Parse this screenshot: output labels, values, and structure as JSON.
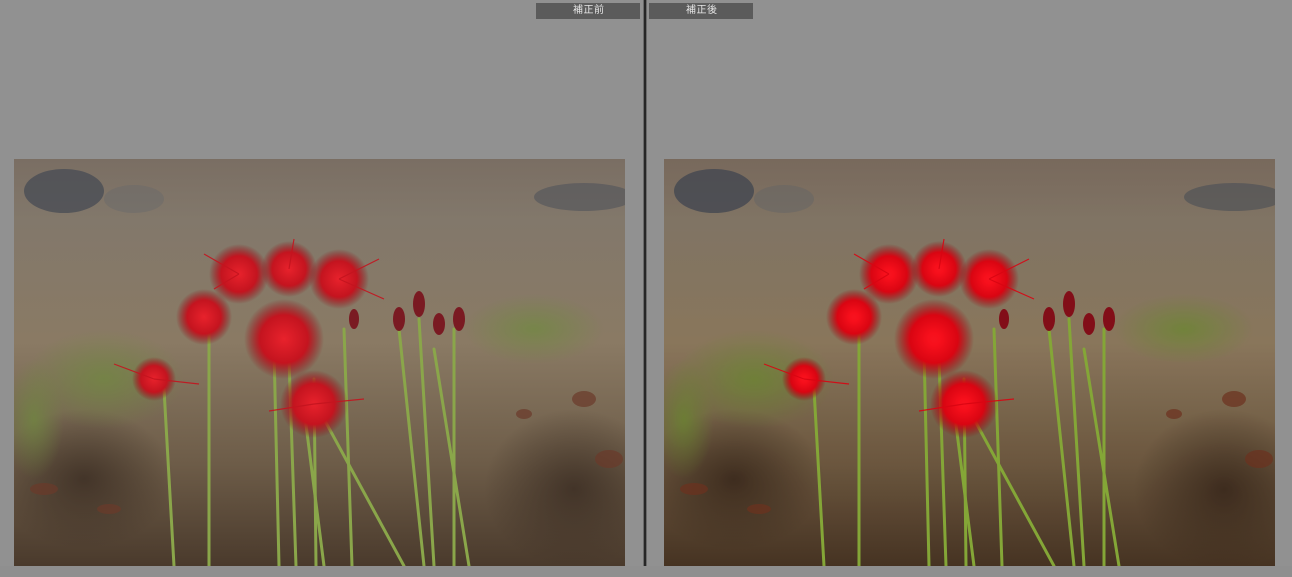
{
  "panes": {
    "before": {
      "label": "補正前",
      "image": "red-spider-lily-field-photo"
    },
    "after": {
      "label": "補正後",
      "image": "red-spider-lily-field-photo"
    }
  },
  "colors": {
    "background": "#8f8f8f",
    "label_bg": "#5b5b5b",
    "divider": "#262626",
    "flower_red": "#d8202a"
  }
}
